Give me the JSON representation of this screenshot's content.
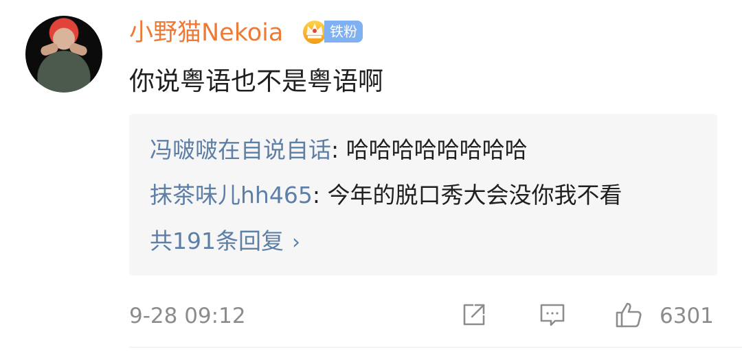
{
  "comment": {
    "username": "小野猫Nekoia",
    "fan_badge": "铁粉",
    "text": "你说粤语也不是粤语啊",
    "timestamp": "9-28 09:12",
    "like_count": "6301"
  },
  "replies": [
    {
      "name": "冯啵啵在自说自话",
      "separator": ": ",
      "text": "哈哈哈哈哈哈哈哈"
    },
    {
      "name": "抹茶味儿hh465",
      "separator": ": ",
      "text": "今年的脱口秀大会没你我不看"
    }
  ],
  "more_replies": {
    "label": "共191条回复"
  },
  "icons": {
    "crown": "crown-icon",
    "share": "share-icon",
    "comment": "comment-icon",
    "like": "thumbs-up-icon",
    "chevron": "chevron-right-icon"
  },
  "colors": {
    "username": "#ee7a36",
    "reply_name": "#5d7fa6",
    "badge": "#7fb0f2",
    "meta_text": "#8c8c8c",
    "reply_bg": "#f6f6f7"
  }
}
